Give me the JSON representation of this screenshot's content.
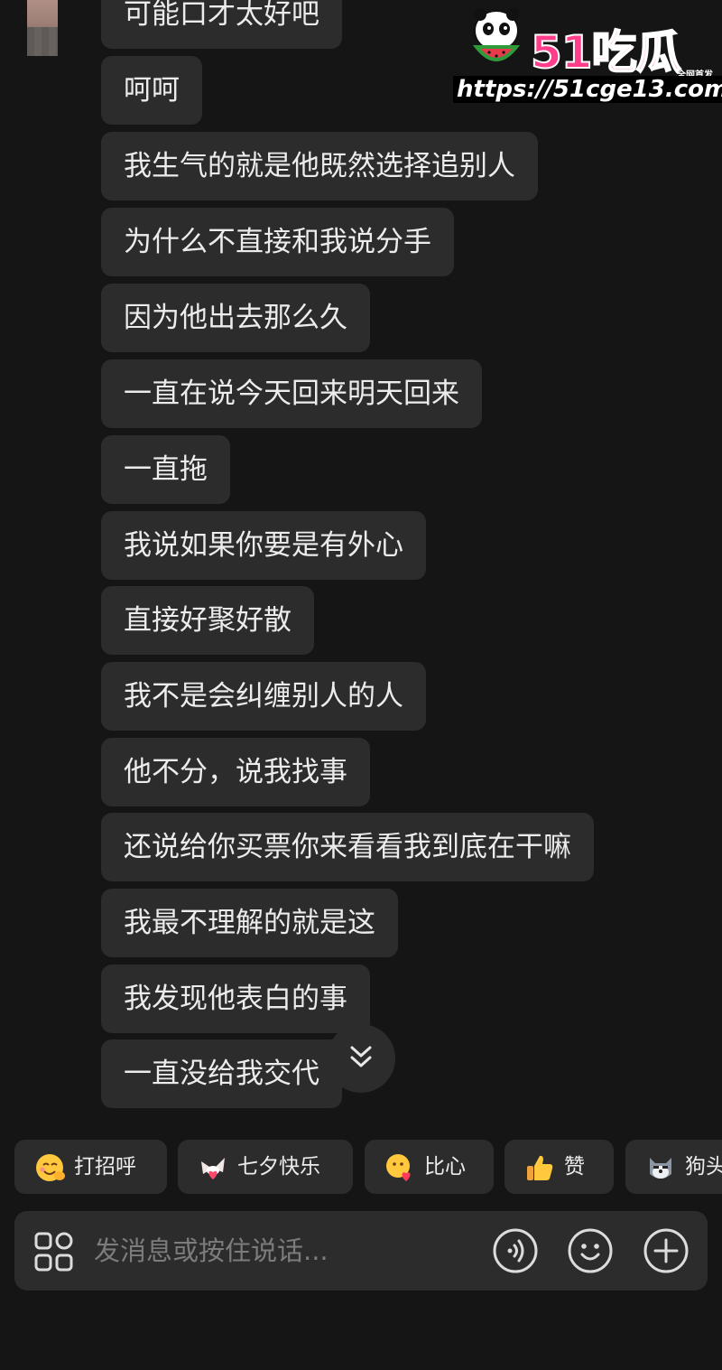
{
  "messages": [
    {
      "text": "可能口才太好吧"
    },
    {
      "text": "呵呵"
    },
    {
      "text": "我生气的就是他既然选择追别人"
    },
    {
      "text": "为什么不直接和我说分手"
    },
    {
      "text": "因为他出去那么久"
    },
    {
      "text": "一直在说今天回来明天回来"
    },
    {
      "text": "一直拖"
    },
    {
      "text": "我说如果你要是有外心"
    },
    {
      "text": "直接好聚好散"
    },
    {
      "text": "我不是会纠缠别人的人"
    },
    {
      "text": "他不分，说我找事"
    },
    {
      "text": "还说给你买票你来看看我到底在干嘛"
    },
    {
      "text": "我最不理解的就是这"
    },
    {
      "text": "我发现他表白的事"
    },
    {
      "text": "一直没给我交代"
    }
  ],
  "watermark": {
    "logo": "51吃瓜",
    "tag": "全网首发",
    "url": "https://51cge13.com"
  },
  "quick_replies": [
    {
      "label": "打招呼",
      "icon": "wave-face-emoji-icon"
    },
    {
      "label": "七夕快乐",
      "icon": "dove-heart-emoji-icon"
    },
    {
      "label": "比心",
      "icon": "finger-heart-emoji-icon"
    },
    {
      "label": "赞",
      "icon": "thumbs-up-emoji-icon"
    },
    {
      "label": "狗头",
      "icon": "dog-head-emoji-icon"
    }
  ],
  "input": {
    "placeholder": "发消息或按住说话..."
  },
  "colors": {
    "background": "#151515",
    "bubble": "#2c2c2c",
    "text": "#ececec",
    "placeholder": "#7c7c7c",
    "watermark_pink": "#ff3d8a"
  }
}
